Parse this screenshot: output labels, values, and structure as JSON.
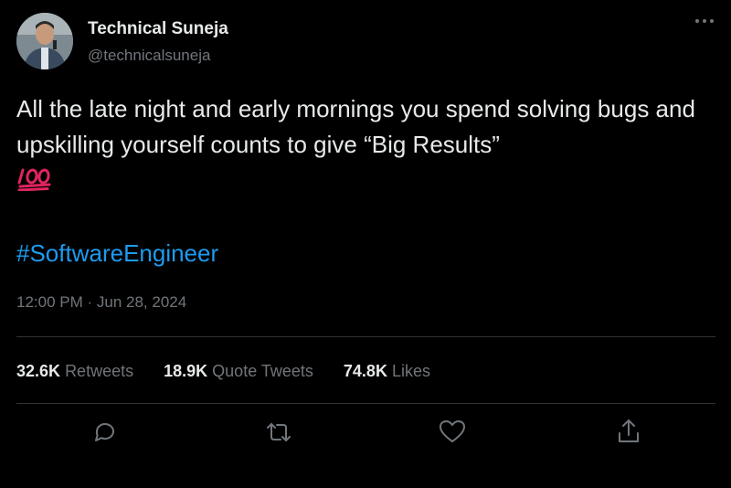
{
  "author": {
    "name": "Technical Suneja",
    "handle": "@technicalsuneja"
  },
  "tweet": {
    "text": "All the late night and early mornings you spend solving bugs and upskilling yourself counts to give “Big Results”",
    "emoji": "💯",
    "hashtag": "#SoftwareEngineer",
    "timestamp": "12:00 PM · Jun 28, 2024"
  },
  "stats": [
    {
      "count": "32.6K",
      "label": "Retweets"
    },
    {
      "count": "18.9K",
      "label": "Quote Tweets"
    },
    {
      "count": "74.8K",
      "label": "Likes"
    }
  ],
  "actions": [
    {
      "icon": "reply-icon"
    },
    {
      "icon": "retweet-icon"
    },
    {
      "icon": "like-icon"
    },
    {
      "icon": "share-icon"
    }
  ],
  "colors": {
    "background": "#000000",
    "text": "#e7e9ea",
    "secondary": "#71767b",
    "accent": "#1d9bf0",
    "emoji_red": "#e0245e"
  }
}
